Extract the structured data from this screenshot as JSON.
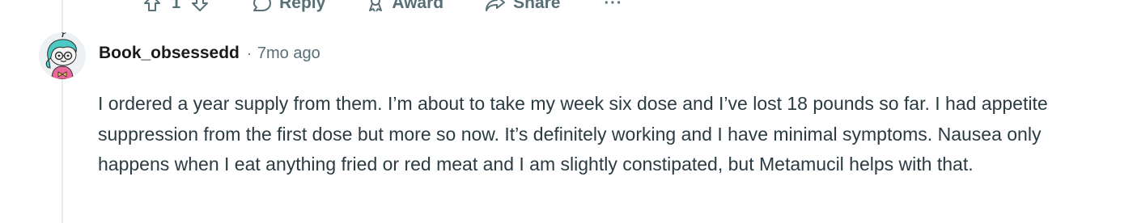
{
  "prev_comment_actions": {
    "vote_count": "1",
    "reply_label": "Reply",
    "award_label": "Award",
    "share_label": "Share",
    "more_label": "···"
  },
  "comment": {
    "author": "Book_obsessedd",
    "separator": "·",
    "time": "7mo ago",
    "body": "I ordered a year supply from them. I’m about to take my week six dose and I’ve lost 18 pounds so far. I had appetite suppression from the first dose but more so now. It’s definitely working and I have minimal symptoms. Nausea only happens when I eat anything fried or red meat and I am slightly constipated, but Metamucil helps with that."
  },
  "icons": {
    "upvote": "upvote-arrow-icon",
    "downvote": "downvote-arrow-icon",
    "reply": "speech-bubble-icon",
    "award": "award-ribbon-icon",
    "share": "share-arrow-icon",
    "avatar": "snoo-avatar-teal-hair-glasses"
  },
  "colors": {
    "meta_text": "#576f76",
    "body_text": "#2a3c42",
    "thread_line": "#e5ebee"
  }
}
